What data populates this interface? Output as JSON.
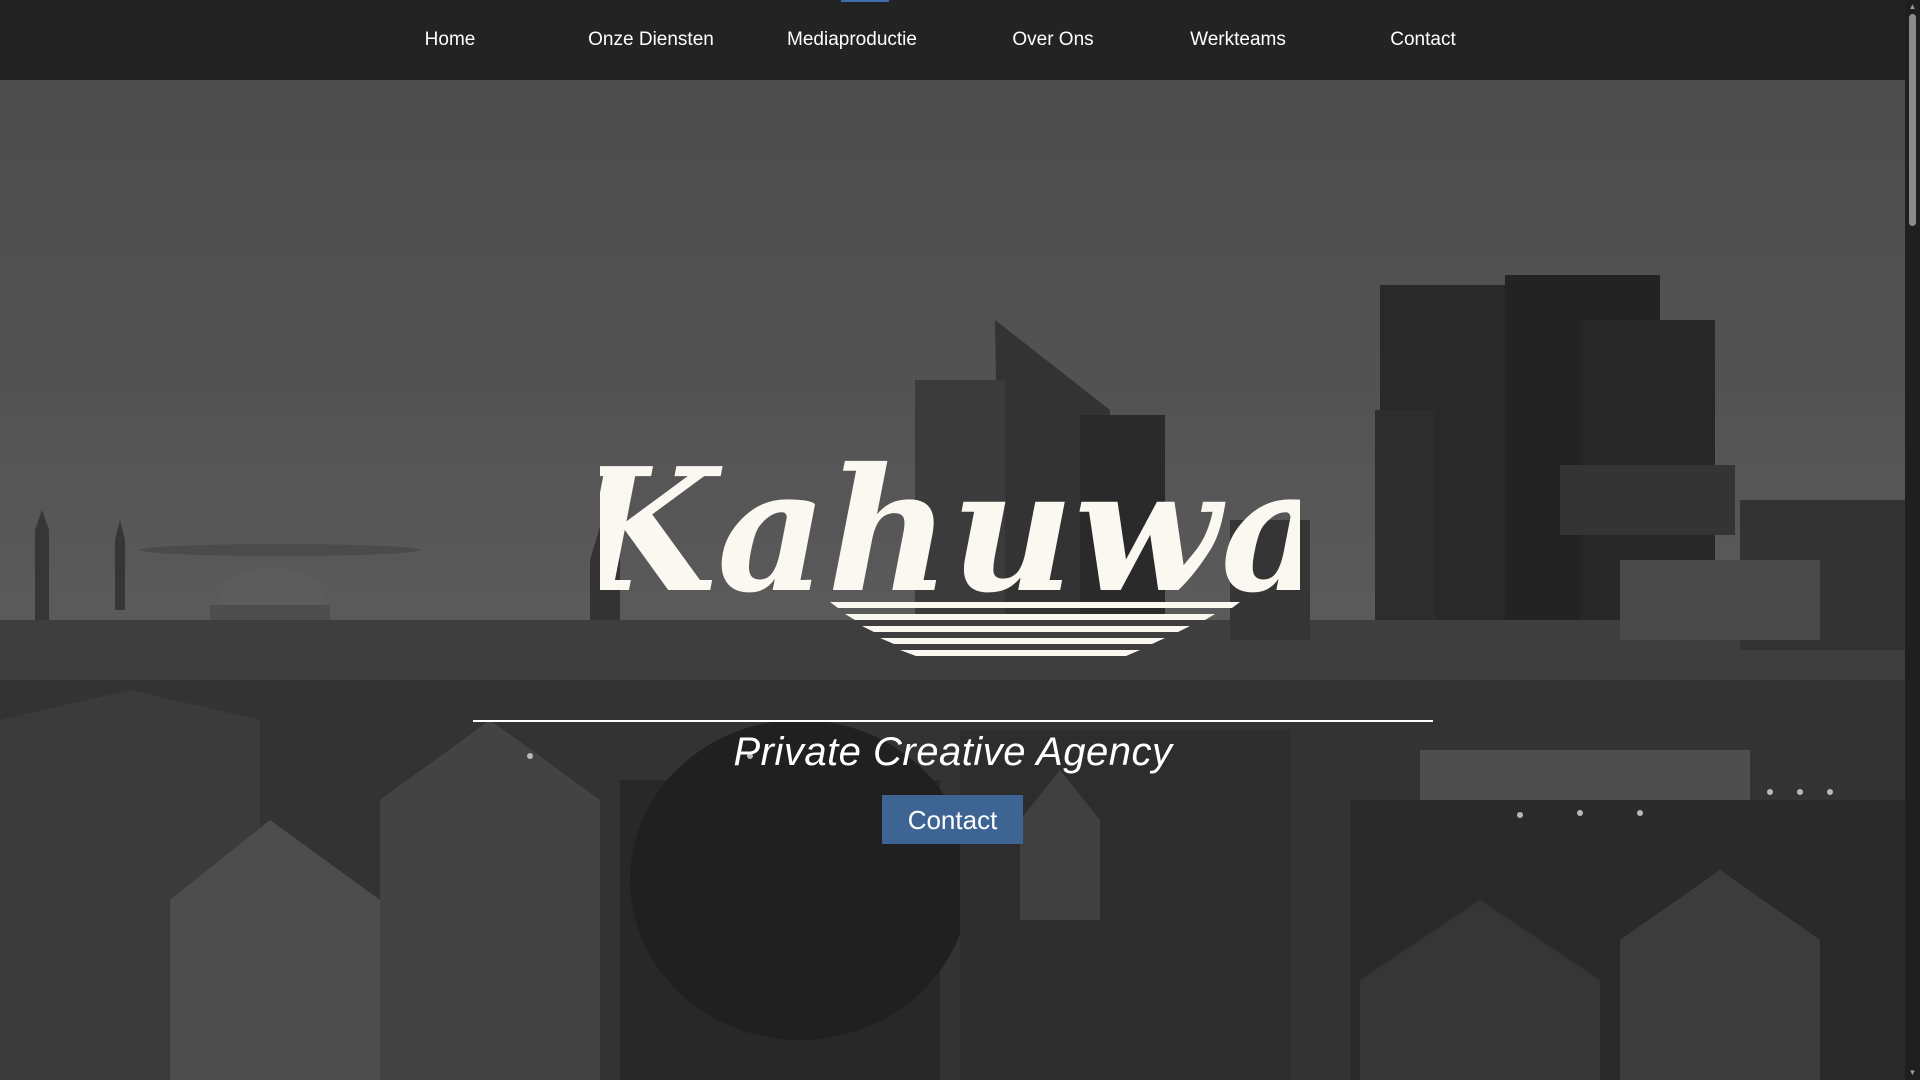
{
  "nav": {
    "items": [
      {
        "label": "Home"
      },
      {
        "label": "Onze Diensten"
      },
      {
        "label": "Mediaproductie"
      },
      {
        "label": "Over Ons"
      },
      {
        "label": "Werkteams"
      },
      {
        "label": "Contact"
      }
    ],
    "active_index": 2
  },
  "hero": {
    "brand_name": "Kahuwa",
    "tagline": "Private Creative Agency",
    "cta_label": "Contact"
  },
  "colors": {
    "navbar_bg": "#232323",
    "nav_active_accent": "#3f6cb0",
    "button_bg": "#3e6494",
    "logo_color": "#fbf8f1",
    "text": "#ffffff"
  },
  "icons": {
    "scroll_up": "chevron-up-icon",
    "scroll_down": "chevron-down-icon"
  }
}
